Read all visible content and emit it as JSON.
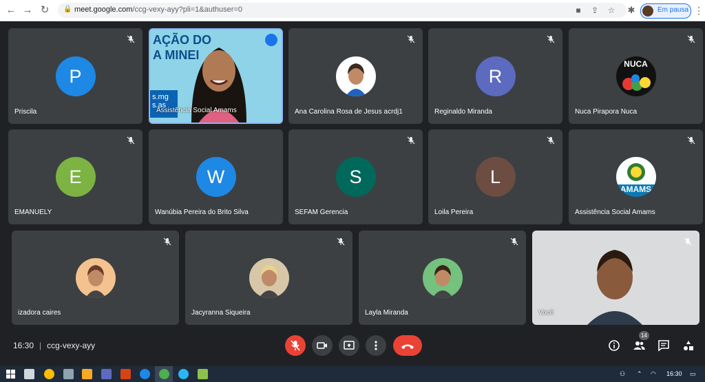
{
  "browser": {
    "url_host": "meet.google.com",
    "url_path": "/ccg-vexy-ayy?pli=1&authuser=0",
    "profile_label": "Em pausa",
    "icons": [
      "back-icon",
      "forward-icon",
      "reload-icon",
      "lock-icon",
      "camera-icon",
      "share-icon",
      "star-icon",
      "extensions-icon",
      "more-icon"
    ]
  },
  "tiles": [
    {
      "name": "Priscila",
      "initial": "P",
      "color": "#1e88e5",
      "muted": true
    },
    {
      "name": "Assistência Social Amams",
      "speaking": true
    },
    {
      "name": "Ana Carolina Rosa de Jesus acrdj1",
      "muted": true
    },
    {
      "name": "Reginaldo Miranda",
      "initial": "R",
      "color": "#5c6bc0",
      "muted": true
    },
    {
      "name": "Nuca Pirapora Nuca",
      "muted": true,
      "logo_text": "NUCA"
    },
    {
      "name": "EMANUELY",
      "initial": "E",
      "color": "#7cb342",
      "muted": true
    },
    {
      "name": "Wanúbia Pereira do Brito Silva",
      "initial": "W",
      "color": "#1e88e5",
      "muted": false
    },
    {
      "name": "SEFAM Gerencia",
      "initial": "S",
      "color": "#00695c",
      "muted": true
    },
    {
      "name": "Loila Pereira",
      "initial": "L",
      "color": "#6d4c41",
      "muted": true
    },
    {
      "name": "Assistência Social Amams",
      "muted": true,
      "logo_text": "AMAMS"
    },
    {
      "name": "izadora caires",
      "muted": true
    },
    {
      "name": "Jacyranna Siqueira",
      "muted": true
    },
    {
      "name": "Layla Miranda",
      "muted": true
    },
    {
      "name": "Você",
      "muted": true
    }
  ],
  "speaker_banner": "AÇÃO DO\nA MINEI",
  "speaker_badge": "s.mg\ns.as",
  "bottom": {
    "time": "16:30",
    "meeting_code": "ccg-vexy-ayy",
    "participants_count": "14"
  },
  "taskbar": {
    "clock": "16:30"
  },
  "colors": {
    "background": "#202124",
    "tile": "#3c4043",
    "danger": "#ea4335",
    "accent": "#1a73e8"
  }
}
